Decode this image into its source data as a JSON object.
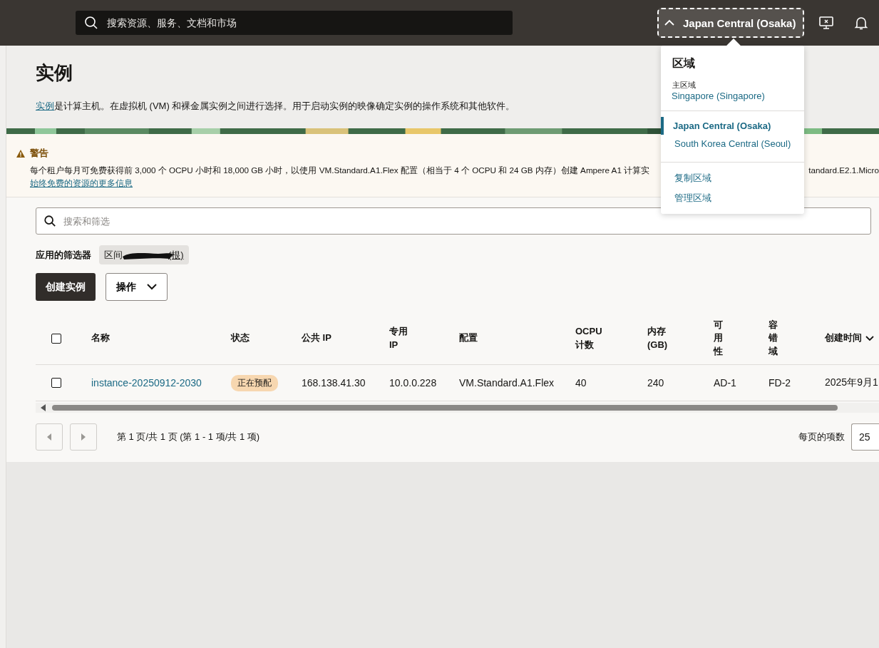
{
  "top_bar": {
    "search": {
      "placeholder": "搜索资源、服务、文档和市场"
    },
    "region_button": {
      "label": "Japan Central (Osaka)",
      "expanded": true
    }
  },
  "region_menu": {
    "title": "区域",
    "home_label": "主区域",
    "home_region": "Singapore (Singapore)",
    "regions": [
      {
        "label": "Japan Central (Osaka)",
        "selected": true
      },
      {
        "label": "South Korea Central (Seoul)",
        "selected": false
      }
    ],
    "actions": [
      "复制区域",
      "管理区域"
    ]
  },
  "page": {
    "title": "实例",
    "intro_link": "实例",
    "intro_text": "是计算主机。在虚拟机 (VM) 和裸金属实例之间进行选择。用于启动实例的映像确定实例的操作系统和其他软件。"
  },
  "warning": {
    "title": "警告",
    "text": "每个租户每月可免费获得前 3,000 个 OCPU 小时和 18,000 GB 小时，以使用 VM.Standard.A1.Flex 配置（相当于 4 个 OCPU 和 24 GB 内存）创建 Ampere A1 计算实",
    "text_tail": "tandard.E2.1.Micro",
    "link": "始终免费的资源的更多信息"
  },
  "filter": {
    "placeholder": "搜索和筛选",
    "applied_label": "应用的筛选器",
    "chip_prefix": "区间",
    "chip_suffix": "(根)"
  },
  "buttons": {
    "create": "创建实例",
    "actions": "操作"
  },
  "table": {
    "all_selected": false,
    "columns": [
      {
        "label": "名称",
        "sorted": false
      },
      {
        "label": "状态",
        "sorted": false
      },
      {
        "label": "公共 IP",
        "sorted": false
      },
      {
        "label": "专用 IP",
        "sorted": false
      },
      {
        "label": "配置",
        "sorted": false
      },
      {
        "label": "OCPU 计数",
        "sorted": false
      },
      {
        "label": "内存 (GB)",
        "sorted": false
      },
      {
        "label": "可用性",
        "sorted": false
      },
      {
        "label": "容错域",
        "sorted": false
      },
      {
        "label": "创建时间",
        "sorted": true
      }
    ],
    "rows": [
      {
        "selected": false,
        "cells": [
          {
            "kind": "link",
            "text": "instance-20250912-2030"
          },
          {
            "kind": "badge",
            "text": "正在预配"
          },
          {
            "kind": "text",
            "text": "168.138.41.30"
          },
          {
            "kind": "text",
            "text": "10.0.0.228"
          },
          {
            "kind": "text",
            "text": "VM.Standard.A1.Flex"
          },
          {
            "kind": "text",
            "text": "40"
          },
          {
            "kind": "text",
            "text": "240"
          },
          {
            "kind": "text",
            "text": "AD-1"
          },
          {
            "kind": "text",
            "text": "FD-2"
          },
          {
            "kind": "text",
            "text": "2025年9月1"
          }
        ]
      }
    ]
  },
  "pagination": {
    "summary": "第 1 页/共 1 页 (第 1 - 1 项/共 1 项)",
    "per_page_label": "每页的项数",
    "per_page": "25"
  }
}
